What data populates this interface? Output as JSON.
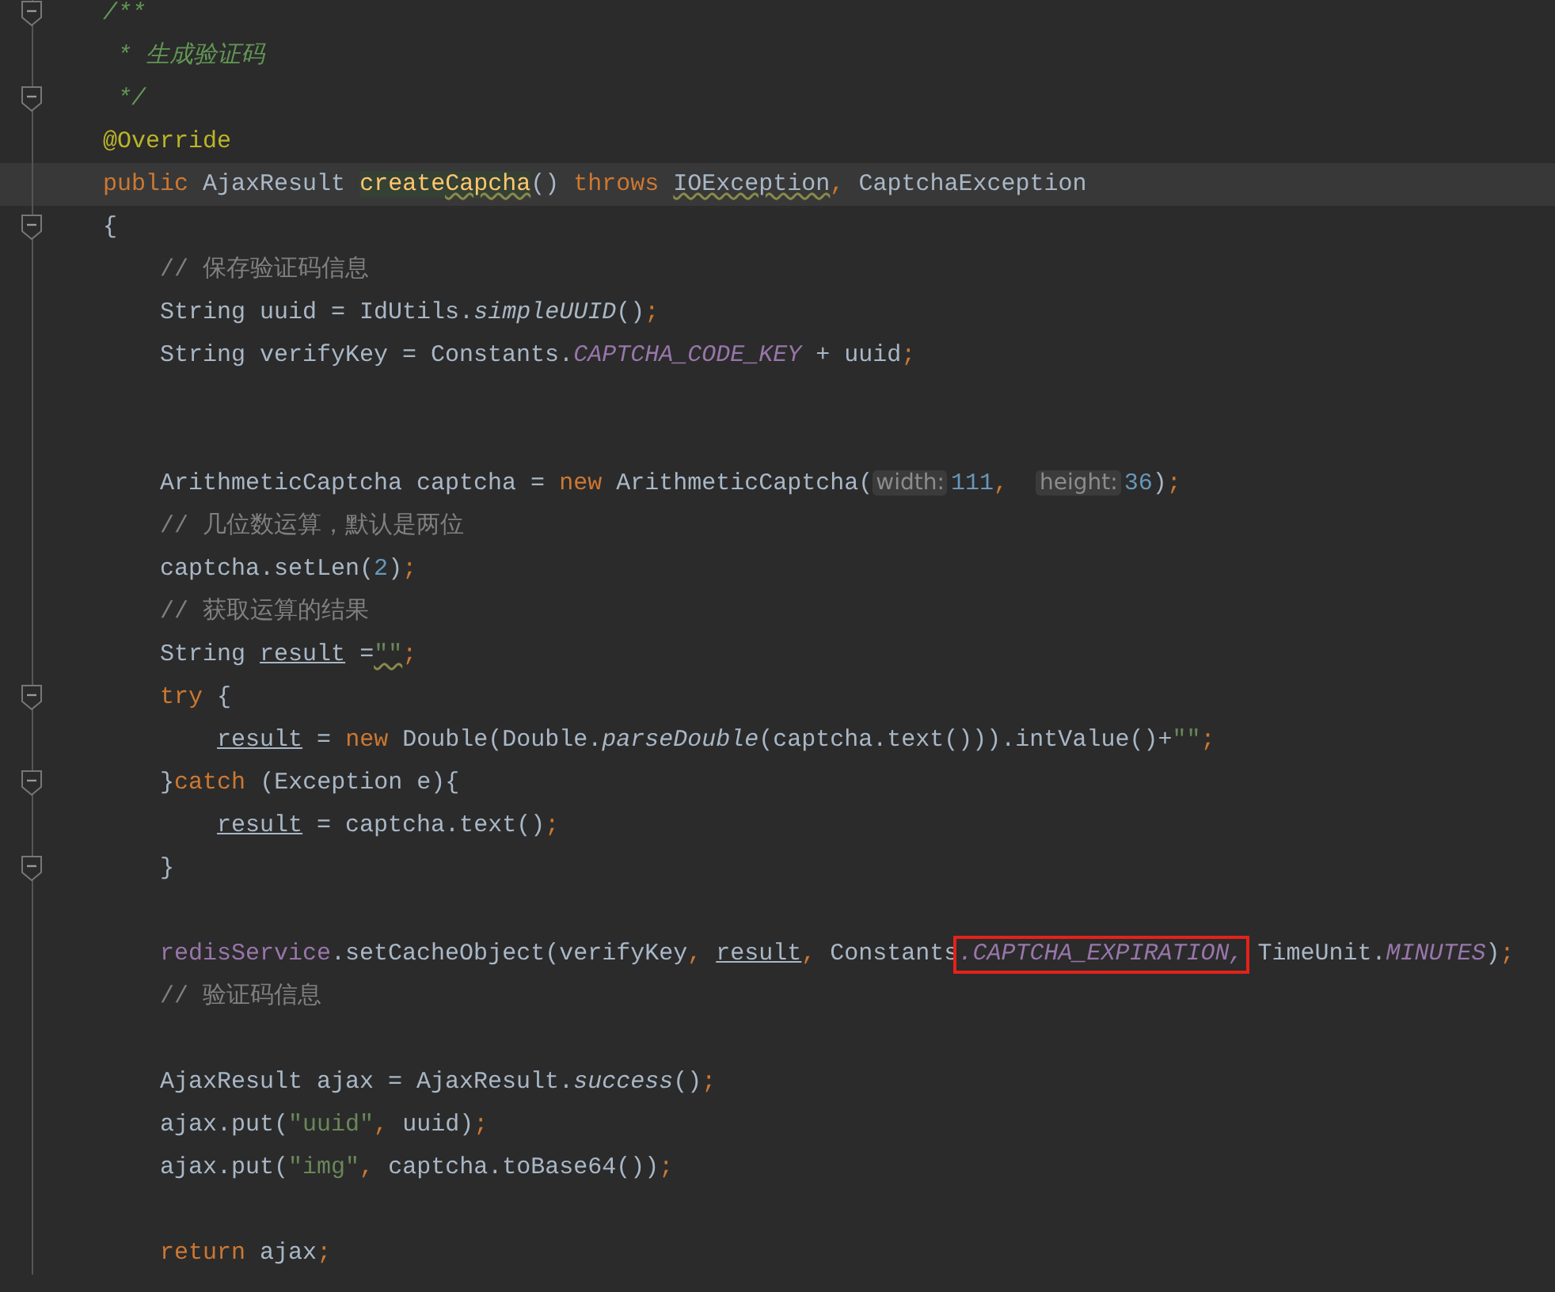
{
  "lines": [
    {
      "fold": true,
      "current": false,
      "tokens": [
        {
          "text": "/**",
          "kind": "doc"
        }
      ]
    },
    {
      "fold": false,
      "current": false,
      "tokens": [
        {
          "text": " * 生成验证码",
          "kind": "doc"
        }
      ]
    },
    {
      "fold": true,
      "current": false,
      "tokens": [
        {
          "text": " */",
          "kind": "doc"
        }
      ]
    },
    {
      "fold": false,
      "current": false,
      "tokens": [
        {
          "text": "@Override",
          "kind": "anno"
        }
      ]
    },
    {
      "fold": false,
      "current": true,
      "tokens": [
        {
          "text": "public",
          "kind": "kw"
        },
        {
          "text": " AjaxResult ",
          "kind": "plain"
        },
        {
          "text": "create",
          "kind": "decl"
        },
        {
          "text": "Capcha",
          "kind": "decl",
          "warn": true
        },
        {
          "text": "() ",
          "kind": "plain"
        },
        {
          "text": "throws",
          "kind": "kw"
        },
        {
          "text": " IOException",
          "kind": "plain",
          "warn": true
        },
        {
          "text": ",",
          "kind": "punct"
        },
        {
          "text": " CaptchaException",
          "kind": "plain"
        }
      ]
    },
    {
      "fold": true,
      "current": false,
      "tokens": [
        {
          "text": "{",
          "kind": "plain"
        }
      ]
    },
    {
      "fold": false,
      "current": false,
      "tokens": [
        {
          "text": "    // 保存验证码信息",
          "kind": "comment"
        }
      ]
    },
    {
      "fold": false,
      "current": false,
      "tokens": [
        {
          "text": "    String uuid = IdUtils.",
          "kind": "plain"
        },
        {
          "text": "simpleUUID",
          "kind": "smethod"
        },
        {
          "text": "()",
          "kind": "plain"
        },
        {
          "text": ";",
          "kind": "punct"
        }
      ]
    },
    {
      "fold": false,
      "current": false,
      "tokens": [
        {
          "text": "    String verifyKey = Constants.",
          "kind": "plain"
        },
        {
          "text": "CAPTCHA_CODE_KEY",
          "kind": "sfield"
        },
        {
          "text": " + uuid",
          "kind": "plain"
        },
        {
          "text": ";",
          "kind": "punct"
        }
      ]
    },
    {
      "fold": false,
      "current": false
    },
    {
      "fold": false,
      "current": false
    },
    {
      "fold": false,
      "current": false,
      "tokens": [
        {
          "text": "    ArithmeticCaptcha captcha = ",
          "kind": "plain"
        },
        {
          "text": "new",
          "kind": "kw"
        },
        {
          "text": " ArithmeticCaptcha(",
          "kind": "plain"
        },
        {
          "text": "width:",
          "kind": "hint"
        },
        {
          "text": "111",
          "kind": "num"
        },
        {
          "text": ",  ",
          "kind": "punct"
        },
        {
          "text": "height:",
          "kind": "hint"
        },
        {
          "text": "36",
          "kind": "num"
        },
        {
          "text": ")",
          "kind": "plain"
        },
        {
          "text": ";",
          "kind": "punct"
        }
      ]
    },
    {
      "fold": false,
      "current": false,
      "tokens": [
        {
          "text": "    // 几位数运算，默认是两位",
          "kind": "comment"
        }
      ]
    },
    {
      "fold": false,
      "current": false,
      "tokens": [
        {
          "text": "    captcha.setLen(",
          "kind": "plain"
        },
        {
          "text": "2",
          "kind": "num"
        },
        {
          "text": ")",
          "kind": "plain"
        },
        {
          "text": ";",
          "kind": "punct"
        }
      ]
    },
    {
      "fold": false,
      "current": false,
      "tokens": [
        {
          "text": "    // 获取运算的结果",
          "kind": "comment"
        }
      ]
    },
    {
      "fold": false,
      "current": false,
      "tokens": [
        {
          "text": "    String ",
          "kind": "plain"
        },
        {
          "text": "result",
          "kind": "var"
        },
        {
          "text": " =",
          "kind": "plain"
        },
        {
          "text": "\"\"",
          "kind": "str",
          "warn": true
        },
        {
          "text": ";",
          "kind": "punct"
        }
      ]
    },
    {
      "fold": true,
      "current": false,
      "tokens": [
        {
          "text": "    try",
          "kind": "kw"
        },
        {
          "text": " {",
          "kind": "plain"
        }
      ]
    },
    {
      "fold": false,
      "current": false,
      "tokens": [
        {
          "text": "        result",
          "kind": "var"
        },
        {
          "text": " = ",
          "kind": "plain"
        },
        {
          "text": "new",
          "kind": "kw"
        },
        {
          "text": " Double(Double.",
          "kind": "plain"
        },
        {
          "text": "parseDouble",
          "kind": "smethod"
        },
        {
          "text": "(captcha.text())).intValue()+",
          "kind": "plain"
        },
        {
          "text": "\"\"",
          "kind": "str"
        },
        {
          "text": ";",
          "kind": "punct"
        }
      ]
    },
    {
      "fold": true,
      "current": false,
      "tokens": [
        {
          "text": "    }",
          "kind": "plain"
        },
        {
          "text": "catch",
          "kind": "kw"
        },
        {
          "text": " (Exception e){",
          "kind": "plain"
        }
      ]
    },
    {
      "fold": false,
      "current": false,
      "tokens": [
        {
          "text": "        result",
          "kind": "var"
        },
        {
          "text": " = captcha.text()",
          "kind": "plain"
        },
        {
          "text": ";",
          "kind": "punct"
        }
      ]
    },
    {
      "fold": true,
      "current": false,
      "tokens": [
        {
          "text": "    }",
          "kind": "plain"
        }
      ]
    },
    {
      "fold": false,
      "current": false
    },
    {
      "fold": false,
      "current": false,
      "tokens": [
        {
          "text": "    redisService",
          "kind": "field"
        },
        {
          "text": ".setCacheObject(verifyKey",
          "kind": "plain"
        },
        {
          "text": ",",
          "kind": "punct"
        },
        {
          "text": " result",
          "kind": "var"
        },
        {
          "text": ",",
          "kind": "punct"
        },
        {
          "text": " Constants",
          "kind": "plain"
        },
        {
          "text": ".CAPTCHA_EXPIRATION,",
          "kind": "sfield",
          "boxed": true
        },
        {
          "text": " TimeUnit.",
          "kind": "plain"
        },
        {
          "text": "MINUTES",
          "kind": "sfield"
        },
        {
          "text": ")",
          "kind": "plain"
        },
        {
          "text": ";",
          "kind": "punct"
        }
      ]
    },
    {
      "fold": false,
      "current": false,
      "tokens": [
        {
          "text": "    // 验证码信息",
          "kind": "comment"
        }
      ]
    },
    {
      "fold": false,
      "current": false
    },
    {
      "fold": false,
      "current": false,
      "tokens": [
        {
          "text": "    AjaxResult ajax = AjaxResult.",
          "kind": "plain"
        },
        {
          "text": "success",
          "kind": "smethod"
        },
        {
          "text": "()",
          "kind": "plain"
        },
        {
          "text": ";",
          "kind": "punct"
        }
      ]
    },
    {
      "fold": false,
      "current": false,
      "tokens": [
        {
          "text": "    ajax.put(",
          "kind": "plain"
        },
        {
          "text": "\"uuid\"",
          "kind": "str"
        },
        {
          "text": ",",
          "kind": "punct"
        },
        {
          "text": " uuid)",
          "kind": "plain"
        },
        {
          "text": ";",
          "kind": "punct"
        }
      ]
    },
    {
      "fold": false,
      "current": false,
      "tokens": [
        {
          "text": "    ajax.put(",
          "kind": "plain"
        },
        {
          "text": "\"img\"",
          "kind": "str"
        },
        {
          "text": ",",
          "kind": "punct"
        },
        {
          "text": " captcha.toBase64())",
          "kind": "plain"
        },
        {
          "text": ";",
          "kind": "punct"
        }
      ]
    },
    {
      "fold": false,
      "current": false
    },
    {
      "fold": false,
      "current": false,
      "tokens": [
        {
          "text": "    return",
          "kind": "kw"
        },
        {
          "text": " ajax",
          "kind": "plain"
        },
        {
          "text": ";",
          "kind": "punct"
        }
      ]
    }
  ]
}
